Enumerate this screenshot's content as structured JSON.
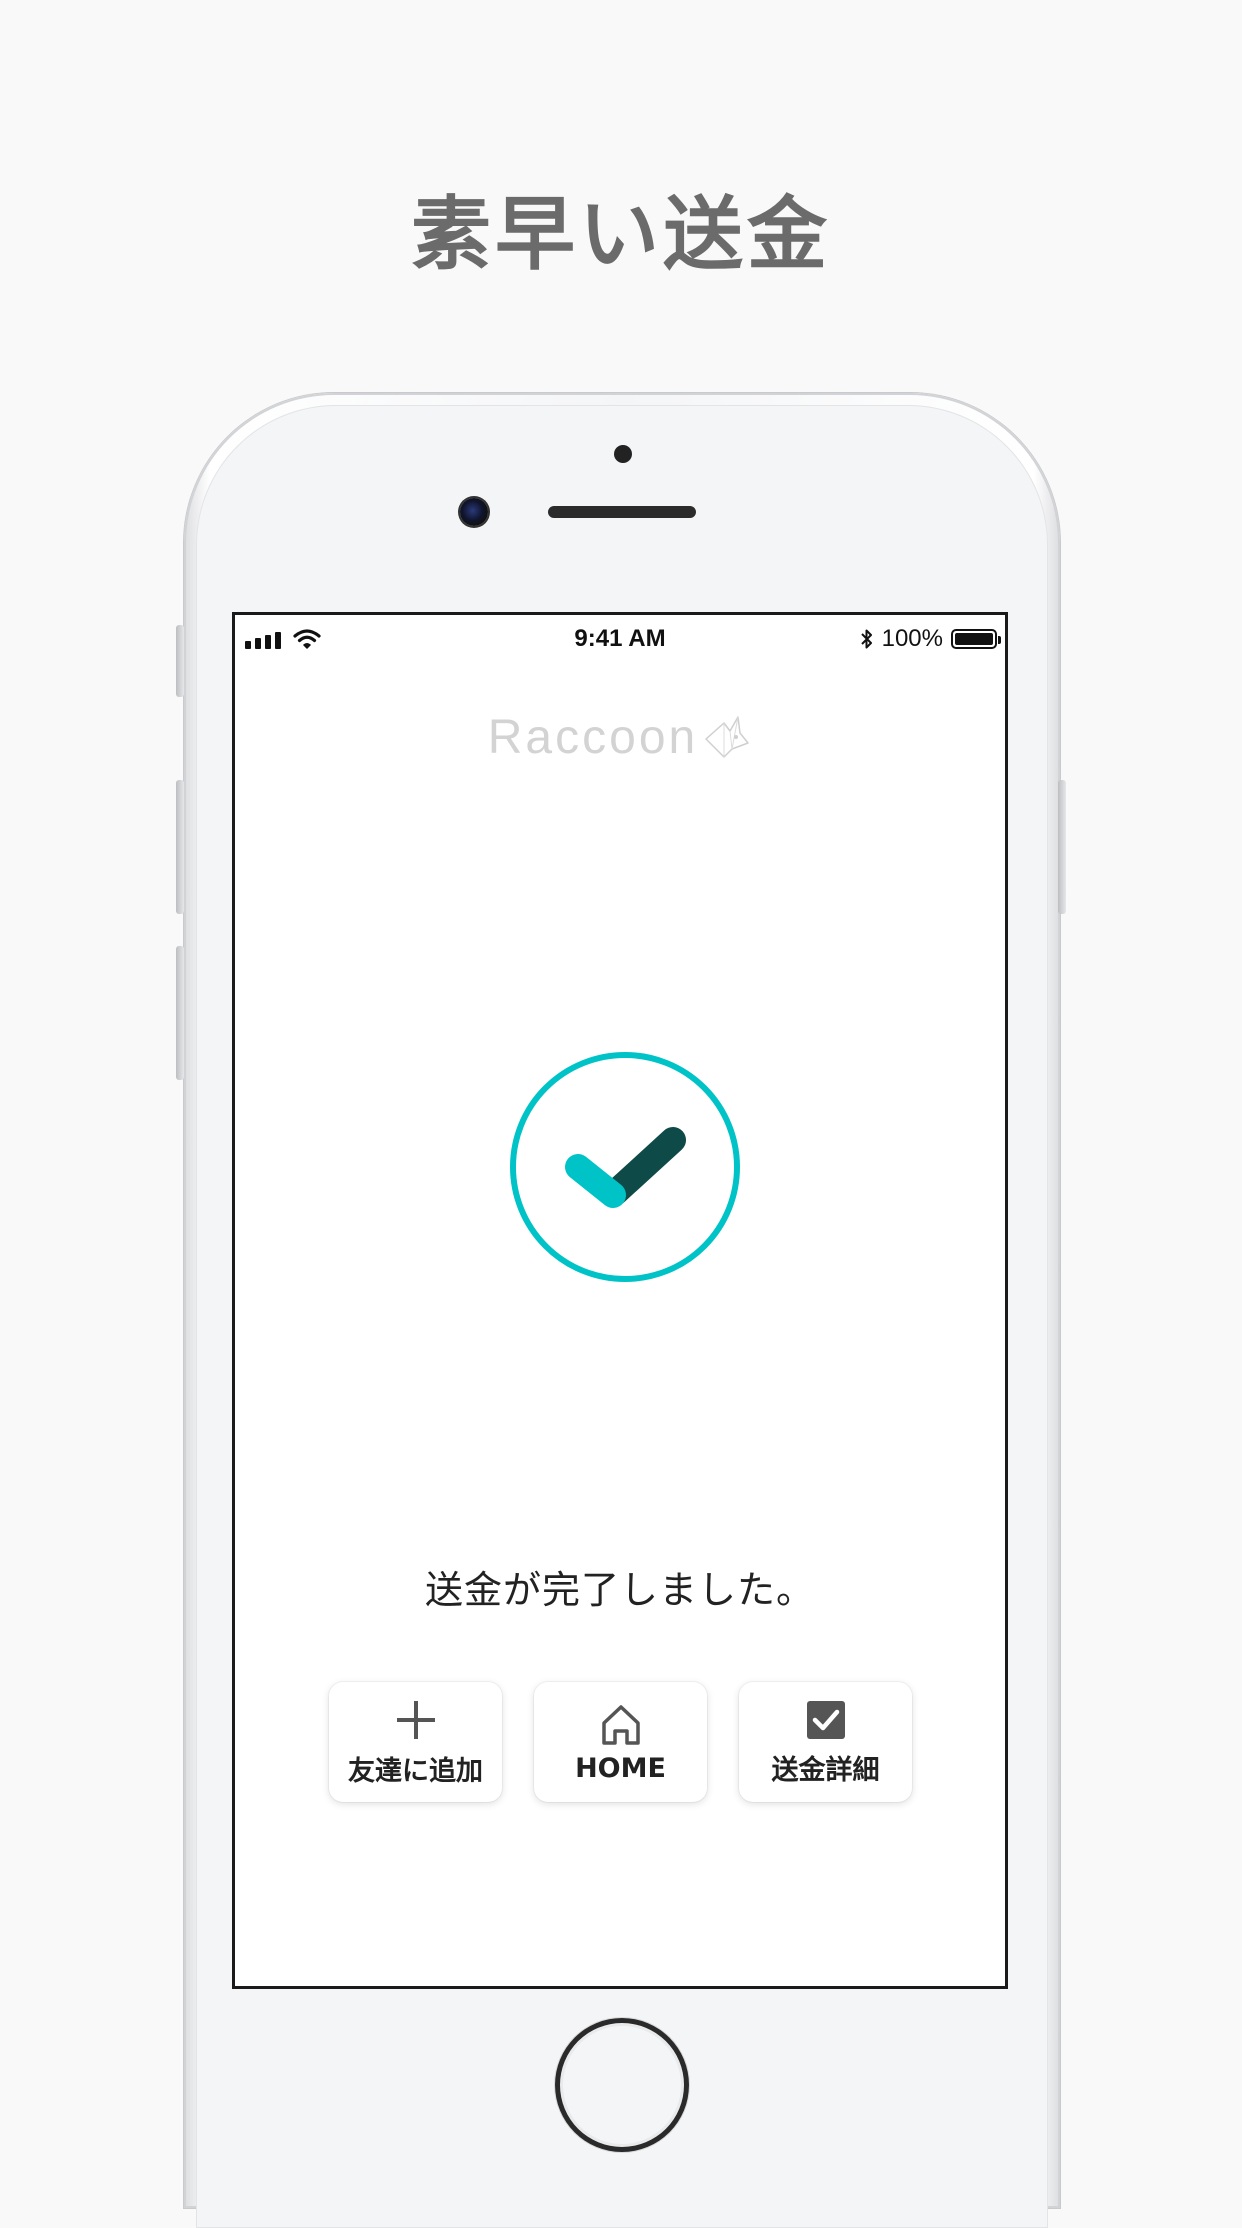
{
  "headline": "素早い送金",
  "status_bar": {
    "time": "9:41 AM",
    "battery_percent": "100%",
    "battery_level": 1.0,
    "signal_icon": "cellular-signal-icon",
    "wifi_icon": "wifi-icon",
    "bluetooth_icon": "bluetooth-icon"
  },
  "app": {
    "logo_text": "Raccoon",
    "success_icon": "check-circle-icon",
    "message": "送金が完了しました。",
    "actions": [
      {
        "label": "友達に追加",
        "icon": "plus-icon"
      },
      {
        "label": "HOME",
        "icon": "home-icon"
      },
      {
        "label": "送金詳細",
        "icon": "checkbox-icon"
      }
    ]
  },
  "colors": {
    "accent": "#00c3c7",
    "accent_dark": "#0e4a48",
    "headline": "#6b6b6b",
    "logo": "#d3d3d3"
  }
}
